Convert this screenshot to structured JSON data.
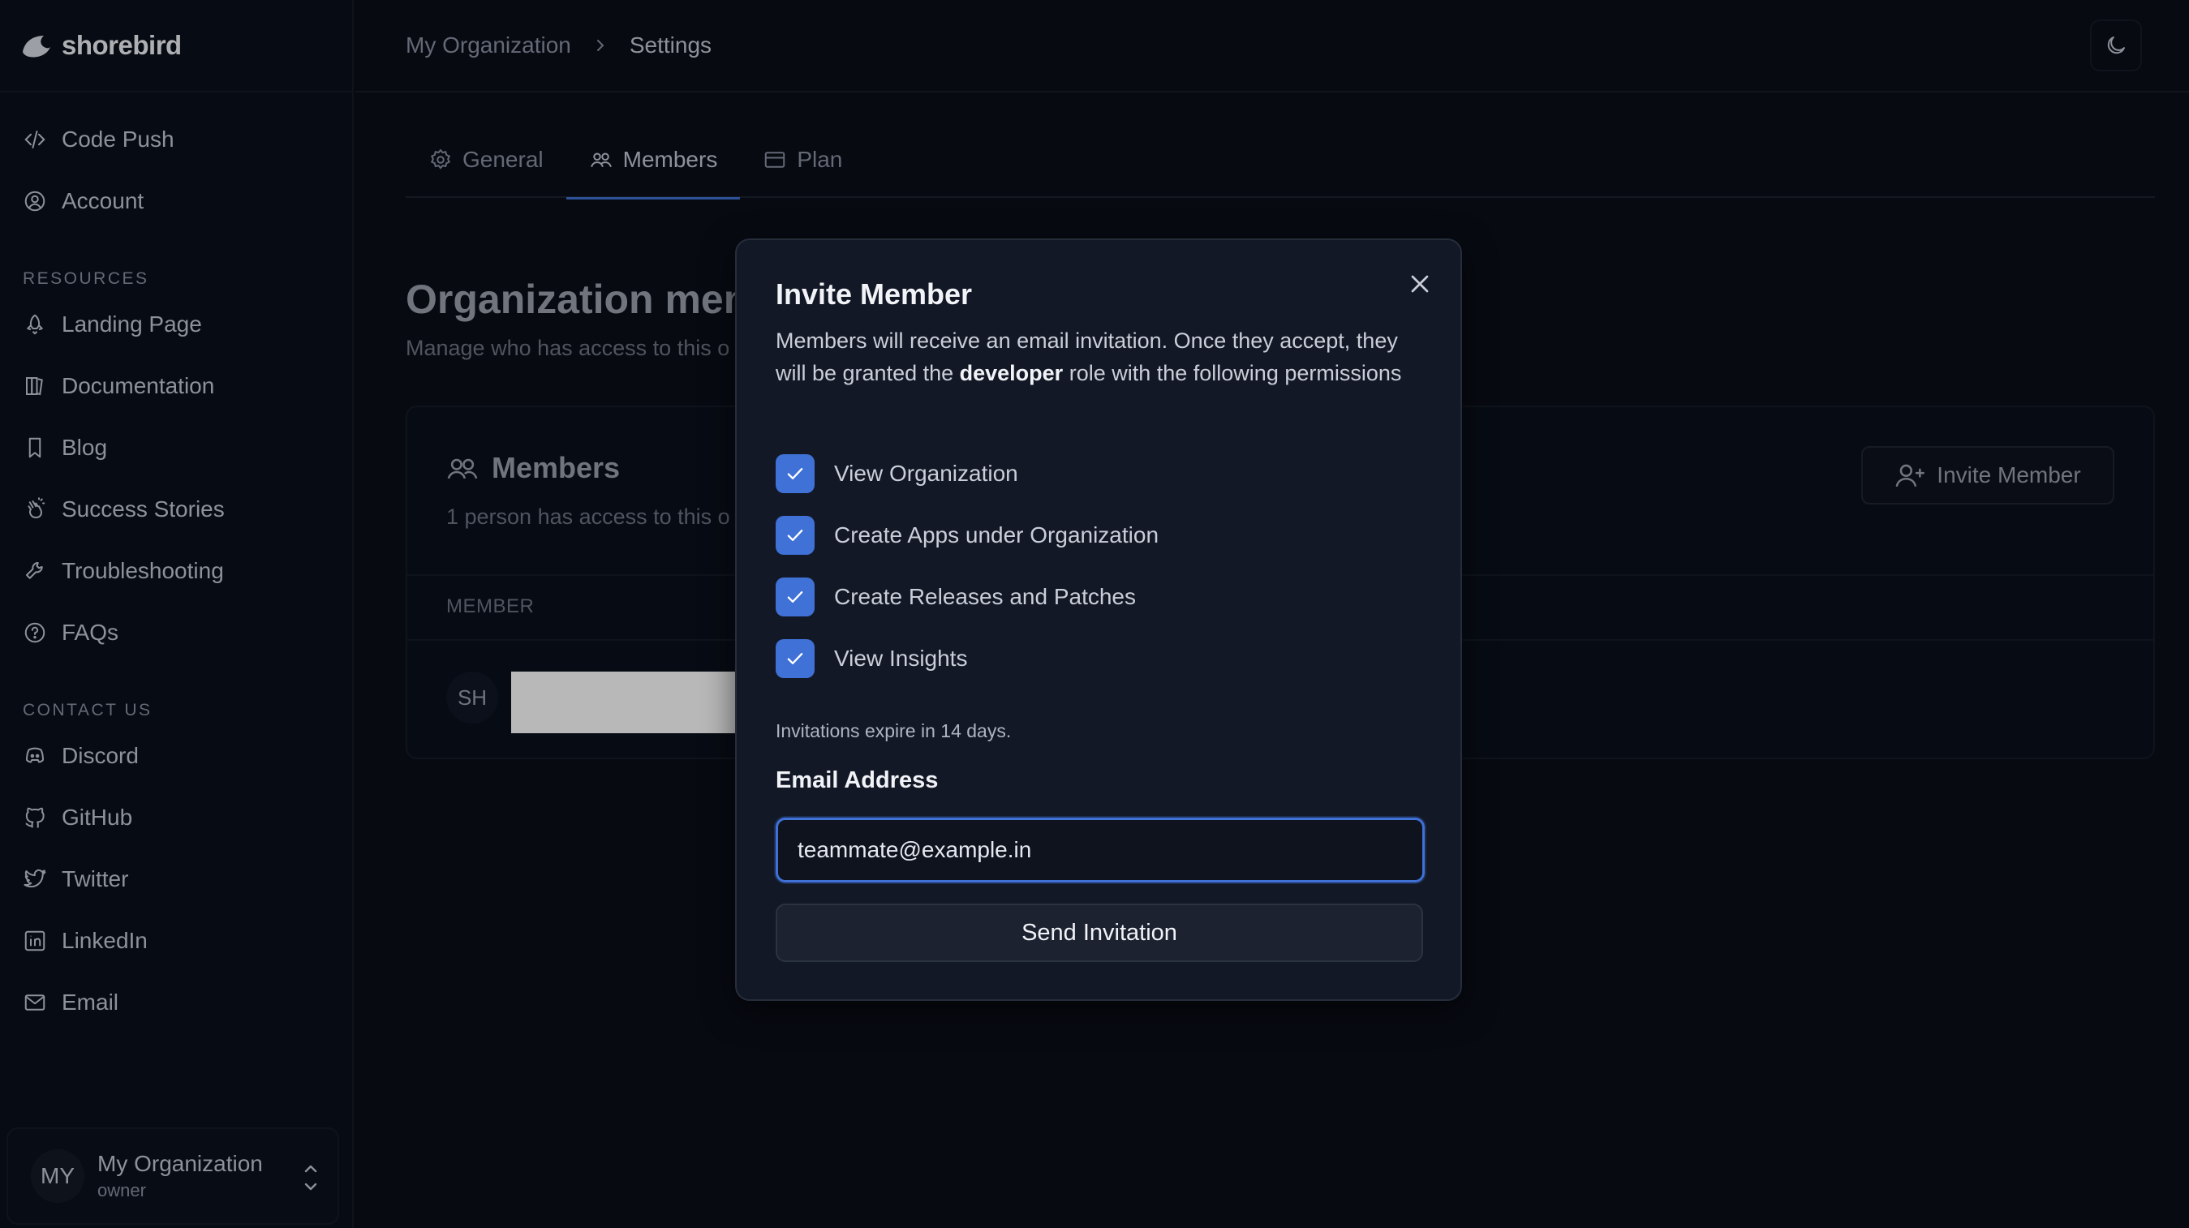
{
  "brand": {
    "name": "shorebird"
  },
  "sidebar": {
    "main_items": [
      {
        "label": "Code Push",
        "icon": "code-icon"
      },
      {
        "label": "Account",
        "icon": "user-circle-icon"
      }
    ],
    "resources_title": "RESOURCES",
    "resources": [
      {
        "label": "Landing Page",
        "icon": "rocket-icon"
      },
      {
        "label": "Documentation",
        "icon": "book-icon"
      },
      {
        "label": "Blog",
        "icon": "bookmark-icon"
      },
      {
        "label": "Success Stories",
        "icon": "hand-clap-icon"
      },
      {
        "label": "Troubleshooting",
        "icon": "wrench-icon"
      },
      {
        "label": "FAQs",
        "icon": "help-circle-icon"
      }
    ],
    "contact_title": "CONTACT US",
    "contact": [
      {
        "label": "Discord",
        "icon": "discord-icon"
      },
      {
        "label": "GitHub",
        "icon": "github-icon"
      },
      {
        "label": "Twitter",
        "icon": "twitter-icon"
      },
      {
        "label": "LinkedIn",
        "icon": "linkedin-icon"
      },
      {
        "label": "Email",
        "icon": "mail-icon"
      }
    ],
    "org": {
      "initials": "MY",
      "name": "My Organization",
      "role": "owner"
    }
  },
  "breadcrumb": {
    "parent": "My Organization",
    "current": "Settings"
  },
  "tabs": [
    {
      "label": "General",
      "icon": "gear-icon"
    },
    {
      "label": "Members",
      "icon": "users-icon"
    },
    {
      "label": "Plan",
      "icon": "credit-card-icon"
    }
  ],
  "page": {
    "title": "Organization mem",
    "subtitle": "Manage who has access to this o"
  },
  "members_card": {
    "title": "Members",
    "subtitle": "1 person has access to this o",
    "invite_button": "Invite Member",
    "column_member": "MEMBER",
    "member_initials": "SH"
  },
  "modal": {
    "title": "Invite Member",
    "desc_before": "Members will receive an email invitation. Once they accept, they will be granted the ",
    "desc_role": "developer",
    "desc_after": " role with the following permissions",
    "permissions": [
      "View Organization",
      "Create Apps under Organization",
      "Create Releases and Patches",
      "View Insights"
    ],
    "expire_note": "Invitations expire in 14 days.",
    "email_label": "Email Address",
    "email_value": "teammate@example.in",
    "send_button": "Send Invitation"
  },
  "colors": {
    "accent": "#3f71d6",
    "background": "#0a0e18",
    "modal": "#131826"
  }
}
